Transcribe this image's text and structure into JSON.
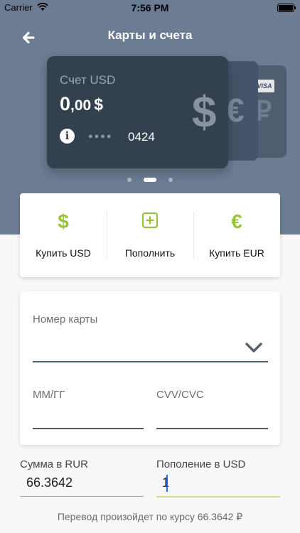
{
  "status_bar": {
    "carrier": "Carrier",
    "time": "7:56 PM"
  },
  "header": {
    "title": "Карты и счета",
    "back_icon": "arrow-left-icon",
    "background": "#6c7c92"
  },
  "card": {
    "label": "Счет USD",
    "balance_int": "0",
    "balance_dec": ",00",
    "currency": "$",
    "currency_glyph": "$",
    "mask": "●●●●",
    "last4": "0424",
    "info_glyph": "i"
  },
  "back_cards": {
    "euro": "€",
    "ruble": "₽",
    "visa": "VISA"
  },
  "pager": {
    "count": 3,
    "active": 1
  },
  "actions": [
    {
      "label": "Купить USD",
      "icon": "dollar-icon",
      "glyph": "$"
    },
    {
      "label": "Пополнить",
      "icon": "plus-square-icon",
      "glyph": ""
    },
    {
      "label": "Купить EUR",
      "icon": "euro-icon",
      "glyph": "€"
    }
  ],
  "form": {
    "card_number_label": "Номер карты",
    "card_number_value": "",
    "expiry_label": "ММ/ГГ",
    "expiry_value": "",
    "cvv_label": "CVV/CVC",
    "cvv_value": ""
  },
  "amount": {
    "rur_label": "Сумма в RUR",
    "rur_value": "66.3642",
    "usd_label": "Пополение в USD",
    "usd_value": "1"
  },
  "hint": "Перевод произойдет по курсу 66.3642 ₽",
  "colors": {
    "accent": "#97c23a",
    "card": "#33414f"
  }
}
